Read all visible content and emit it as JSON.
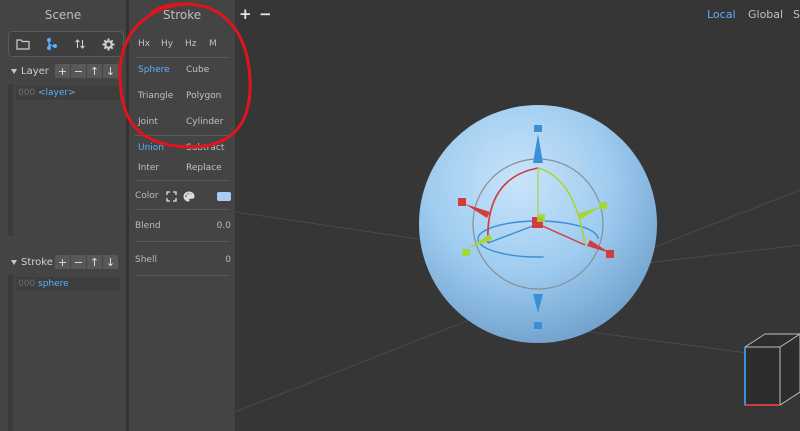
{
  "scene": {
    "title": "Scene",
    "toolbar_icons": [
      "folder-icon",
      "hierarchy-icon",
      "sort-icon",
      "gear-icon"
    ],
    "layer_section": {
      "label": "Layer",
      "buttons": [
        "+",
        "−",
        "↑",
        "↓"
      ]
    },
    "layers": [
      {
        "num": "000",
        "name": "<layer>"
      }
    ],
    "stroke_section": {
      "label": "Stroke",
      "buttons": [
        "+",
        "−",
        "↑",
        "↓"
      ]
    },
    "strokes": [
      {
        "num": "000",
        "name": "sphere"
      }
    ]
  },
  "stroke_panel": {
    "title": "Stroke",
    "symmetry": [
      "Hx",
      "Hy",
      "Hz",
      "M"
    ],
    "shapes": [
      [
        "Sphere",
        "Cube"
      ],
      [
        "Triangle",
        "Polygon"
      ],
      [
        "Joint",
        "Cylinder"
      ]
    ],
    "selected_shape": "Sphere",
    "operations": [
      [
        "Union",
        "Subtract"
      ],
      [
        "Inter",
        "Replace"
      ]
    ],
    "selected_operation": "Union",
    "color_label": "Color",
    "color_value": "#a7cdf2",
    "blend_label": "Blend",
    "blend_value": "0.0",
    "shell_label": "Shell",
    "shell_value": "0"
  },
  "viewport": {
    "add_label": "+",
    "remove_label": "−",
    "spaces": [
      "Local",
      "Global",
      "S"
    ],
    "active_space": "Local"
  },
  "colors": {
    "accent": "#5ab0ff",
    "annotation": "#e0141c",
    "sphere": "#9ccbef",
    "axis_x": "#d23c3c",
    "axis_y": "#a5d63a",
    "axis_z": "#3a8fd6"
  }
}
